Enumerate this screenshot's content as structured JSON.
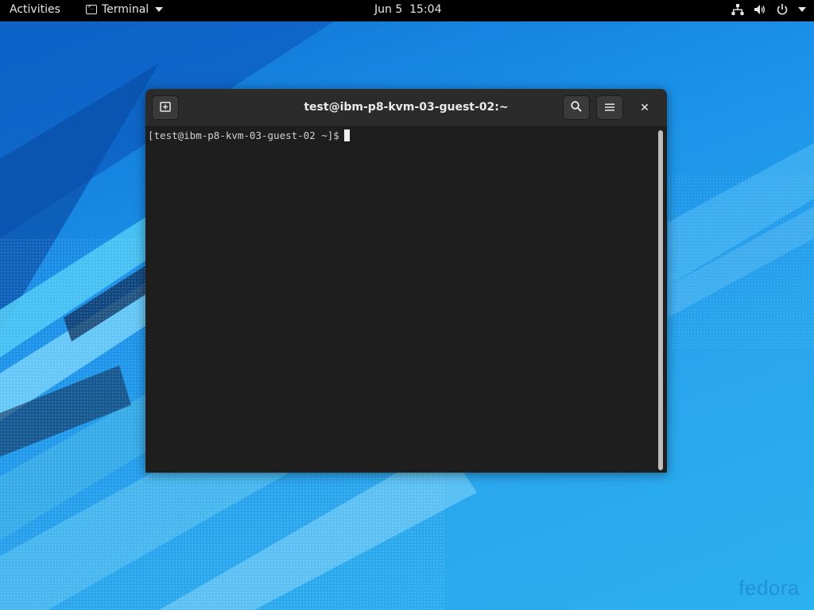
{
  "topbar": {
    "activities_label": "Activities",
    "app_name": "Terminal",
    "date": "Jun 5",
    "time": "15:04",
    "tray_icons": [
      "network-icon",
      "volume-icon",
      "power-icon"
    ]
  },
  "window": {
    "title": "test@ibm-p8-kvm-03-guest-02:~",
    "buttons": [
      "new-tab-icon",
      "search-icon",
      "hamburger-menu-icon",
      "close-icon"
    ],
    "close_glyph": "✕"
  },
  "terminal": {
    "prompt": "[test@ibm-p8-kvm-03-guest-02 ~]$"
  },
  "desktop": {
    "logo_text": "fedora"
  },
  "colors": {
    "topbar_bg": "#000000",
    "headerbar_bg": "#2b2b2b",
    "terminal_bg": "#1e1e1e",
    "wallpaper_primary": "#1a8fe8"
  }
}
